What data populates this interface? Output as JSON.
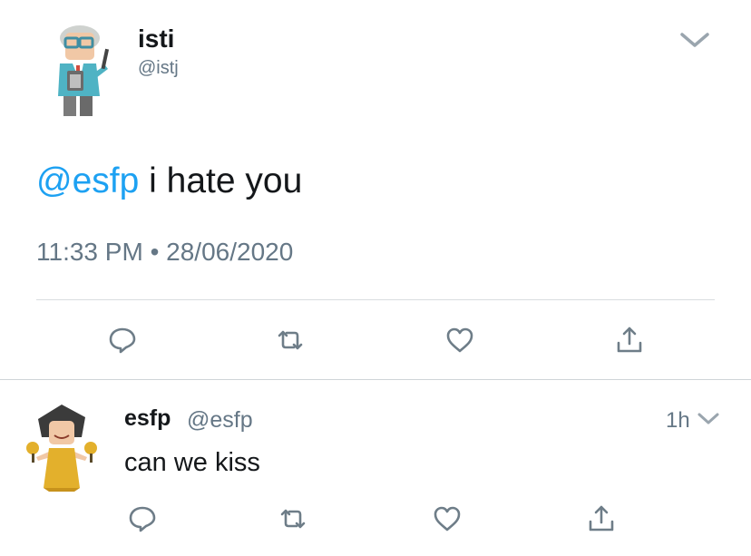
{
  "tweet": {
    "display_name": "isti",
    "handle": "@istj",
    "mention": "@esfp",
    "text": " i hate you",
    "time": "11:33 PM",
    "separator": "•",
    "date": "28/06/2020"
  },
  "reply": {
    "display_name": "esfp",
    "handle": "@esfp",
    "relative_time": "1h",
    "text": "can we kiss"
  },
  "colors": {
    "accent": "#1da1f2",
    "secondary_text": "#657786",
    "primary_text": "#14171a",
    "divider": "#d9dde0"
  },
  "icons": {
    "reply": "speech-bubble-icon",
    "retweet": "retweet-icon",
    "like": "heart-icon",
    "share": "share-icon",
    "menu": "chevron-down-icon"
  }
}
